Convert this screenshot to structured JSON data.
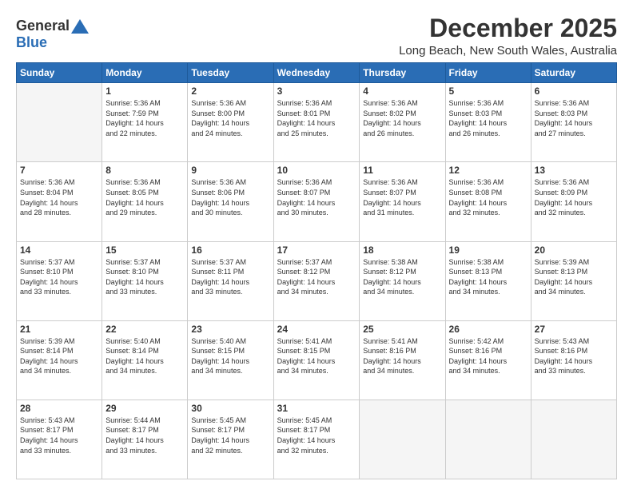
{
  "logo": {
    "general": "General",
    "blue": "Blue"
  },
  "title": "December 2025",
  "location": "Long Beach, New South Wales, Australia",
  "days_of_week": [
    "Sunday",
    "Monday",
    "Tuesday",
    "Wednesday",
    "Thursday",
    "Friday",
    "Saturday"
  ],
  "weeks": [
    [
      {
        "day": "",
        "info": ""
      },
      {
        "day": "1",
        "info": "Sunrise: 5:36 AM\nSunset: 7:59 PM\nDaylight: 14 hours\nand 22 minutes."
      },
      {
        "day": "2",
        "info": "Sunrise: 5:36 AM\nSunset: 8:00 PM\nDaylight: 14 hours\nand 24 minutes."
      },
      {
        "day": "3",
        "info": "Sunrise: 5:36 AM\nSunset: 8:01 PM\nDaylight: 14 hours\nand 25 minutes."
      },
      {
        "day": "4",
        "info": "Sunrise: 5:36 AM\nSunset: 8:02 PM\nDaylight: 14 hours\nand 26 minutes."
      },
      {
        "day": "5",
        "info": "Sunrise: 5:36 AM\nSunset: 8:03 PM\nDaylight: 14 hours\nand 26 minutes."
      },
      {
        "day": "6",
        "info": "Sunrise: 5:36 AM\nSunset: 8:03 PM\nDaylight: 14 hours\nand 27 minutes."
      }
    ],
    [
      {
        "day": "7",
        "info": "Sunrise: 5:36 AM\nSunset: 8:04 PM\nDaylight: 14 hours\nand 28 minutes."
      },
      {
        "day": "8",
        "info": "Sunrise: 5:36 AM\nSunset: 8:05 PM\nDaylight: 14 hours\nand 29 minutes."
      },
      {
        "day": "9",
        "info": "Sunrise: 5:36 AM\nSunset: 8:06 PM\nDaylight: 14 hours\nand 30 minutes."
      },
      {
        "day": "10",
        "info": "Sunrise: 5:36 AM\nSunset: 8:07 PM\nDaylight: 14 hours\nand 30 minutes."
      },
      {
        "day": "11",
        "info": "Sunrise: 5:36 AM\nSunset: 8:07 PM\nDaylight: 14 hours\nand 31 minutes."
      },
      {
        "day": "12",
        "info": "Sunrise: 5:36 AM\nSunset: 8:08 PM\nDaylight: 14 hours\nand 32 minutes."
      },
      {
        "day": "13",
        "info": "Sunrise: 5:36 AM\nSunset: 8:09 PM\nDaylight: 14 hours\nand 32 minutes."
      }
    ],
    [
      {
        "day": "14",
        "info": "Sunrise: 5:37 AM\nSunset: 8:10 PM\nDaylight: 14 hours\nand 33 minutes."
      },
      {
        "day": "15",
        "info": "Sunrise: 5:37 AM\nSunset: 8:10 PM\nDaylight: 14 hours\nand 33 minutes."
      },
      {
        "day": "16",
        "info": "Sunrise: 5:37 AM\nSunset: 8:11 PM\nDaylight: 14 hours\nand 33 minutes."
      },
      {
        "day": "17",
        "info": "Sunrise: 5:37 AM\nSunset: 8:12 PM\nDaylight: 14 hours\nand 34 minutes."
      },
      {
        "day": "18",
        "info": "Sunrise: 5:38 AM\nSunset: 8:12 PM\nDaylight: 14 hours\nand 34 minutes."
      },
      {
        "day": "19",
        "info": "Sunrise: 5:38 AM\nSunset: 8:13 PM\nDaylight: 14 hours\nand 34 minutes."
      },
      {
        "day": "20",
        "info": "Sunrise: 5:39 AM\nSunset: 8:13 PM\nDaylight: 14 hours\nand 34 minutes."
      }
    ],
    [
      {
        "day": "21",
        "info": "Sunrise: 5:39 AM\nSunset: 8:14 PM\nDaylight: 14 hours\nand 34 minutes."
      },
      {
        "day": "22",
        "info": "Sunrise: 5:40 AM\nSunset: 8:14 PM\nDaylight: 14 hours\nand 34 minutes."
      },
      {
        "day": "23",
        "info": "Sunrise: 5:40 AM\nSunset: 8:15 PM\nDaylight: 14 hours\nand 34 minutes."
      },
      {
        "day": "24",
        "info": "Sunrise: 5:41 AM\nSunset: 8:15 PM\nDaylight: 14 hours\nand 34 minutes."
      },
      {
        "day": "25",
        "info": "Sunrise: 5:41 AM\nSunset: 8:16 PM\nDaylight: 14 hours\nand 34 minutes."
      },
      {
        "day": "26",
        "info": "Sunrise: 5:42 AM\nSunset: 8:16 PM\nDaylight: 14 hours\nand 34 minutes."
      },
      {
        "day": "27",
        "info": "Sunrise: 5:43 AM\nSunset: 8:16 PM\nDaylight: 14 hours\nand 33 minutes."
      }
    ],
    [
      {
        "day": "28",
        "info": "Sunrise: 5:43 AM\nSunset: 8:17 PM\nDaylight: 14 hours\nand 33 minutes."
      },
      {
        "day": "29",
        "info": "Sunrise: 5:44 AM\nSunset: 8:17 PM\nDaylight: 14 hours\nand 33 minutes."
      },
      {
        "day": "30",
        "info": "Sunrise: 5:45 AM\nSunset: 8:17 PM\nDaylight: 14 hours\nand 32 minutes."
      },
      {
        "day": "31",
        "info": "Sunrise: 5:45 AM\nSunset: 8:17 PM\nDaylight: 14 hours\nand 32 minutes."
      },
      {
        "day": "",
        "info": ""
      },
      {
        "day": "",
        "info": ""
      },
      {
        "day": "",
        "info": ""
      }
    ]
  ]
}
